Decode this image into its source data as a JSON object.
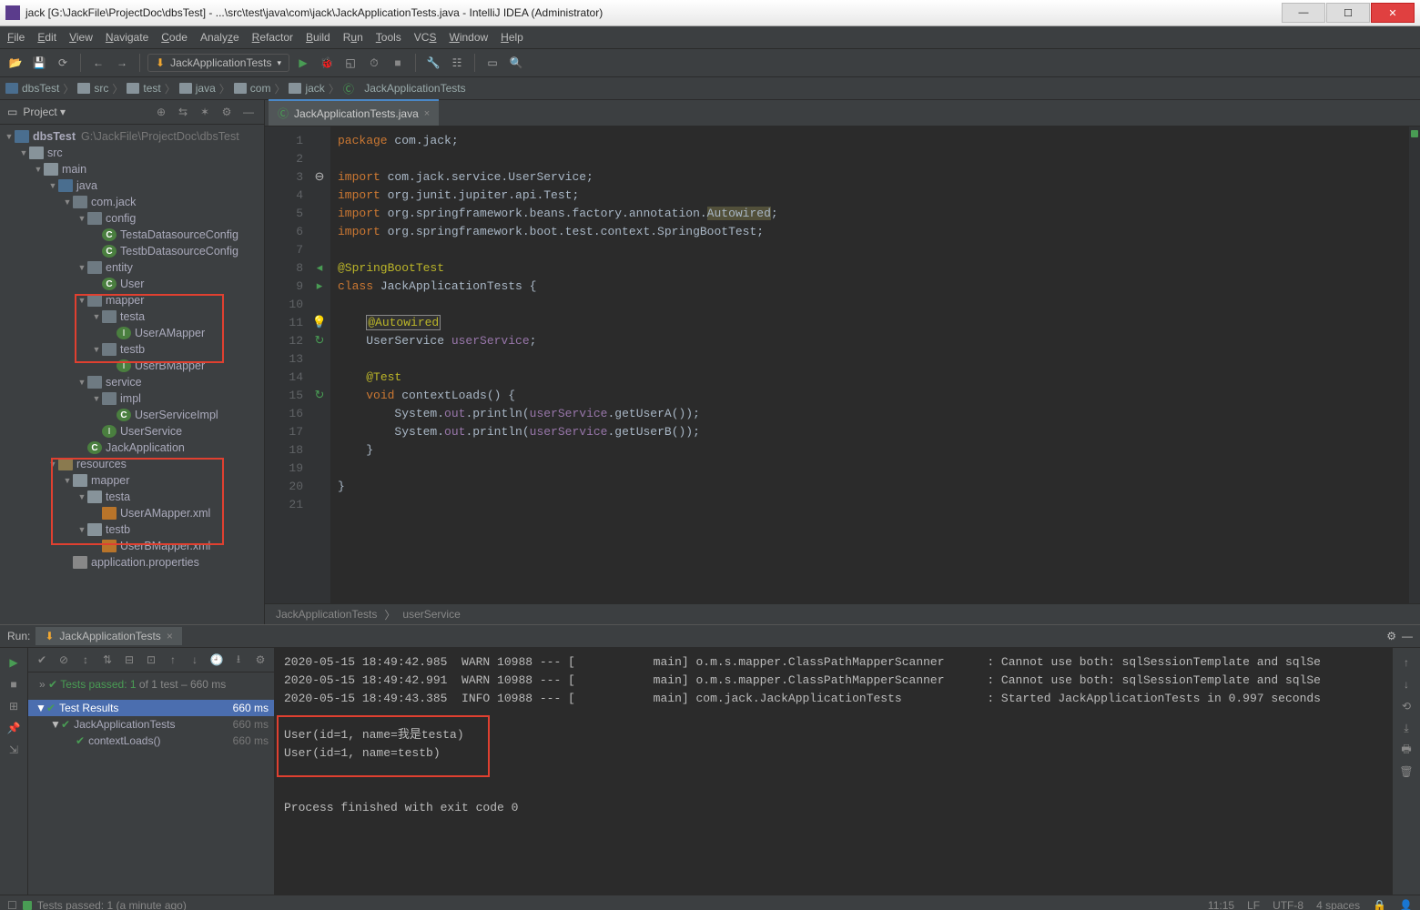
{
  "window": {
    "title": "jack [G:\\JackFile\\ProjectDoc\\dbsTest] - ...\\src\\test\\java\\com\\jack\\JackApplicationTests.java - IntelliJ IDEA (Administrator)"
  },
  "menu": [
    "File",
    "Edit",
    "View",
    "Navigate",
    "Code",
    "Analyze",
    "Refactor",
    "Build",
    "Run",
    "Tools",
    "VCS",
    "Window",
    "Help"
  ],
  "runConfig": "JackApplicationTests",
  "breadcrumbs": [
    "dbsTest",
    "src",
    "test",
    "java",
    "com",
    "jack",
    "JackApplicationTests"
  ],
  "projectPanel": {
    "title": "Project"
  },
  "tree": {
    "root": {
      "name": "dbsTest",
      "path": "G:\\JackFile\\ProjectDoc\\dbsTest"
    },
    "src": "src",
    "main": "main",
    "java": "java",
    "comjack": "com.jack",
    "config": "config",
    "testaDS": "TestaDatasourceConfig",
    "testbDS": "TestbDatasourceConfig",
    "entity": "entity",
    "user": "User",
    "mapper": "mapper",
    "testa": "testa",
    "userAMapper": "UserAMapper",
    "testb": "testb",
    "userBMapper": "UserBMapper",
    "service": "service",
    "impl": "impl",
    "userServiceImpl": "UserServiceImpl",
    "userService": "UserService",
    "jackApp": "JackApplication",
    "resources": "resources",
    "mapperR": "mapper",
    "testaR": "testa",
    "userAMx": "UserAMapper.xml",
    "testbR": "testb",
    "userBMx": "UserBMapper.xml",
    "appProps": "application.properties"
  },
  "editorTab": "JackApplicationTests.java",
  "code": {
    "l1": "package com.jack;",
    "l3": "import com.jack.service.UserService;",
    "l4": "import org.junit.jupiter.api.Test;",
    "l5a": "import org.springframework.beans.factory.annotation.",
    "l5b": "Autowired",
    "l5c": ";",
    "l6": "import org.springframework.boot.test.context.SpringBootTest;",
    "l8": "@SpringBootTest",
    "l9a": "class ",
    "l9b": "JackApplicationTests {",
    "l11": "@Autowired",
    "l12a": "UserService ",
    "l12b": "userService",
    "l12c": ";",
    "l14": "@Test",
    "l15a": "void ",
    "l15b": "contextLoads() {",
    "l16a": "System.",
    "l16b": "out",
    "l16c": ".println(",
    "l16d": "userService",
    "l16e": ".getUserA());",
    "l17a": "System.",
    "l17b": "out",
    "l17c": ".println(",
    "l17d": "userService",
    "l17e": ".getUserB());",
    "l18": "}",
    "l20": "}"
  },
  "editorCrumbs": [
    "JackApplicationTests",
    "userService"
  ],
  "run": {
    "label": "Run:",
    "tab": "JackApplicationTests",
    "passed": "Tests passed: 1",
    "passedOf": " of 1 test – 660 ms",
    "testRoot": "Test Results",
    "testRootMs": "660 ms",
    "test1": "JackApplicationTests",
    "test1ms": "660 ms",
    "test2": "contextLoads()",
    "test2ms": "660 ms",
    "log1": "2020-05-15 18:49:42.985  WARN 10988 --- [           main] o.m.s.mapper.ClassPathMapperScanner      : Cannot use both: sqlSessionTemplate and sqlSe",
    "log2": "2020-05-15 18:49:42.991  WARN 10988 --- [           main] o.m.s.mapper.ClassPathMapperScanner      : Cannot use both: sqlSessionTemplate and sqlSe",
    "log3": "2020-05-15 18:49:43.385  INFO 10988 --- [           main] com.jack.JackApplicationTests            : Started JackApplicationTests in 0.997 seconds",
    "out1": "User(id=1, name=我是testa)",
    "out2": "User(id=1, name=testb)",
    "exit": "Process finished with exit code 0"
  },
  "status": {
    "msg": "Tests passed: 1 (a minute ago)",
    "pos": "11:15",
    "lf": "LF",
    "enc": "UTF-8",
    "indent": "4 spaces"
  }
}
